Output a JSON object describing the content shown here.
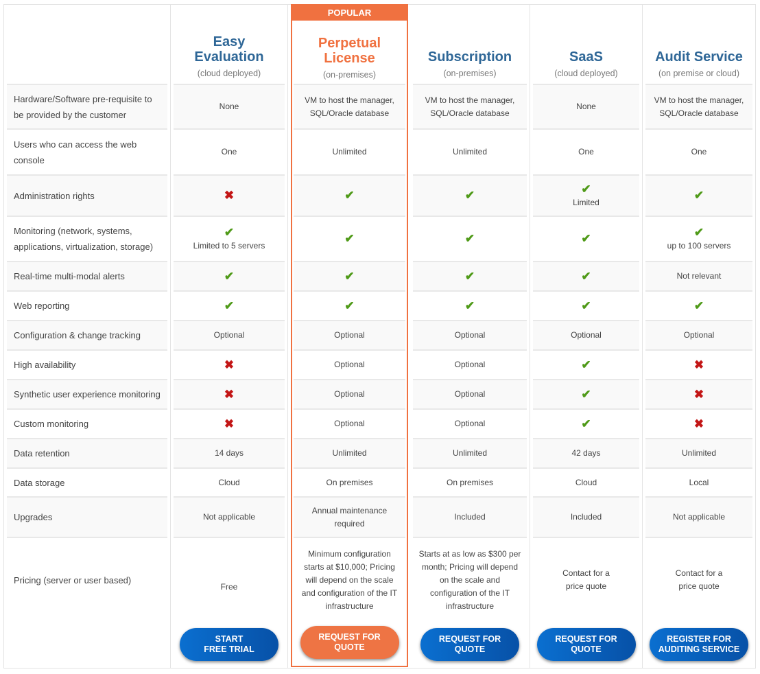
{
  "popular_badge": "POPULAR",
  "features": [
    "Hardware/Software pre-requisite to be provided by the customer",
    "Users who can access the web console",
    "Administration rights",
    "Monitoring (network, systems, applications, virtualization, storage)",
    "Real-time multi-modal alerts",
    "Web reporting",
    "Configuration & change tracking",
    "High availability",
    "Synthetic user experience monitoring",
    "Custom monitoring",
    "Data retention",
    "Data storage",
    "Upgrades",
    "Pricing (server or user based)"
  ],
  "plans": [
    {
      "title": "Easy Evaluation",
      "subtitle": "(cloud deployed)",
      "popular": false,
      "button": "START\nFREE TRIAL",
      "values": [
        {
          "text": "None"
        },
        {
          "text": "One"
        },
        {
          "icon": "cross"
        },
        {
          "icon": "check",
          "text": "Limited to 5 servers"
        },
        {
          "icon": "check"
        },
        {
          "icon": "check"
        },
        {
          "text": "Optional"
        },
        {
          "icon": "cross"
        },
        {
          "icon": "cross"
        },
        {
          "icon": "cross"
        },
        {
          "text": "14 days"
        },
        {
          "text": "Cloud"
        },
        {
          "text": "Not applicable"
        },
        {
          "text": "Free"
        }
      ]
    },
    {
      "title": "Perpetual License",
      "subtitle": "(on-premises)",
      "popular": true,
      "button": "REQUEST FOR\nQUOTE",
      "values": [
        {
          "text": "VM to host the manager, SQL/Oracle database"
        },
        {
          "text": "Unlimited"
        },
        {
          "icon": "check"
        },
        {
          "icon": "check"
        },
        {
          "icon": "check"
        },
        {
          "icon": "check"
        },
        {
          "text": "Optional"
        },
        {
          "text": "Optional"
        },
        {
          "text": "Optional"
        },
        {
          "text": "Optional"
        },
        {
          "text": "Unlimited"
        },
        {
          "text": "On premises"
        },
        {
          "text": "Annual maintenance required"
        },
        {
          "text": "Minimum configuration starts at $10,000; Pricing will depend on the scale and configuration of the IT infrastructure"
        }
      ]
    },
    {
      "title": "Subscription",
      "subtitle": "(on-premises)",
      "popular": false,
      "button": "REQUEST FOR\nQUOTE",
      "values": [
        {
          "text": "VM to host the manager, SQL/Oracle database"
        },
        {
          "text": "Unlimited"
        },
        {
          "icon": "check"
        },
        {
          "icon": "check"
        },
        {
          "icon": "check"
        },
        {
          "icon": "check"
        },
        {
          "text": "Optional"
        },
        {
          "text": "Optional"
        },
        {
          "text": "Optional"
        },
        {
          "text": "Optional"
        },
        {
          "text": "Unlimited"
        },
        {
          "text": "On premises"
        },
        {
          "text": "Included"
        },
        {
          "text": "Starts at as low as $300 per month; Pricing will depend on the scale and configuration of the IT infrastructure"
        }
      ]
    },
    {
      "title": "SaaS",
      "subtitle": "(cloud deployed)",
      "popular": false,
      "button": "REQUEST FOR\nQUOTE",
      "values": [
        {
          "text": "None"
        },
        {
          "text": "One"
        },
        {
          "icon": "check",
          "text": "Limited"
        },
        {
          "icon": "check"
        },
        {
          "icon": "check"
        },
        {
          "icon": "check"
        },
        {
          "text": "Optional"
        },
        {
          "icon": "check"
        },
        {
          "icon": "check"
        },
        {
          "icon": "check"
        },
        {
          "text": "42 days"
        },
        {
          "text": "Cloud"
        },
        {
          "text": "Included"
        },
        {
          "text": "Contact for a price quote"
        }
      ]
    },
    {
      "title": "Audit Service",
      "subtitle": "(on premise or cloud)",
      "popular": false,
      "button": "REGISTER FOR\nAUDITING SERVICE",
      "values": [
        {
          "text": "VM to host the manager, SQL/Oracle database"
        },
        {
          "text": "One"
        },
        {
          "icon": "check"
        },
        {
          "icon": "check",
          "text": "up to 100 servers"
        },
        {
          "text": "Not relevant"
        },
        {
          "icon": "check"
        },
        {
          "text": "Optional"
        },
        {
          "icon": "cross"
        },
        {
          "icon": "cross"
        },
        {
          "icon": "cross"
        },
        {
          "text": "Unlimited"
        },
        {
          "text": "Local"
        },
        {
          "text": "Not applicable"
        },
        {
          "text": "Contact for a price quote"
        }
      ]
    }
  ],
  "colors": {
    "brand_blue": "#2f6797",
    "popular_orange": "#f07140",
    "check_green": "#4f9a18",
    "cross_red": "#c31616",
    "button_blue": "#0a6fd0"
  }
}
